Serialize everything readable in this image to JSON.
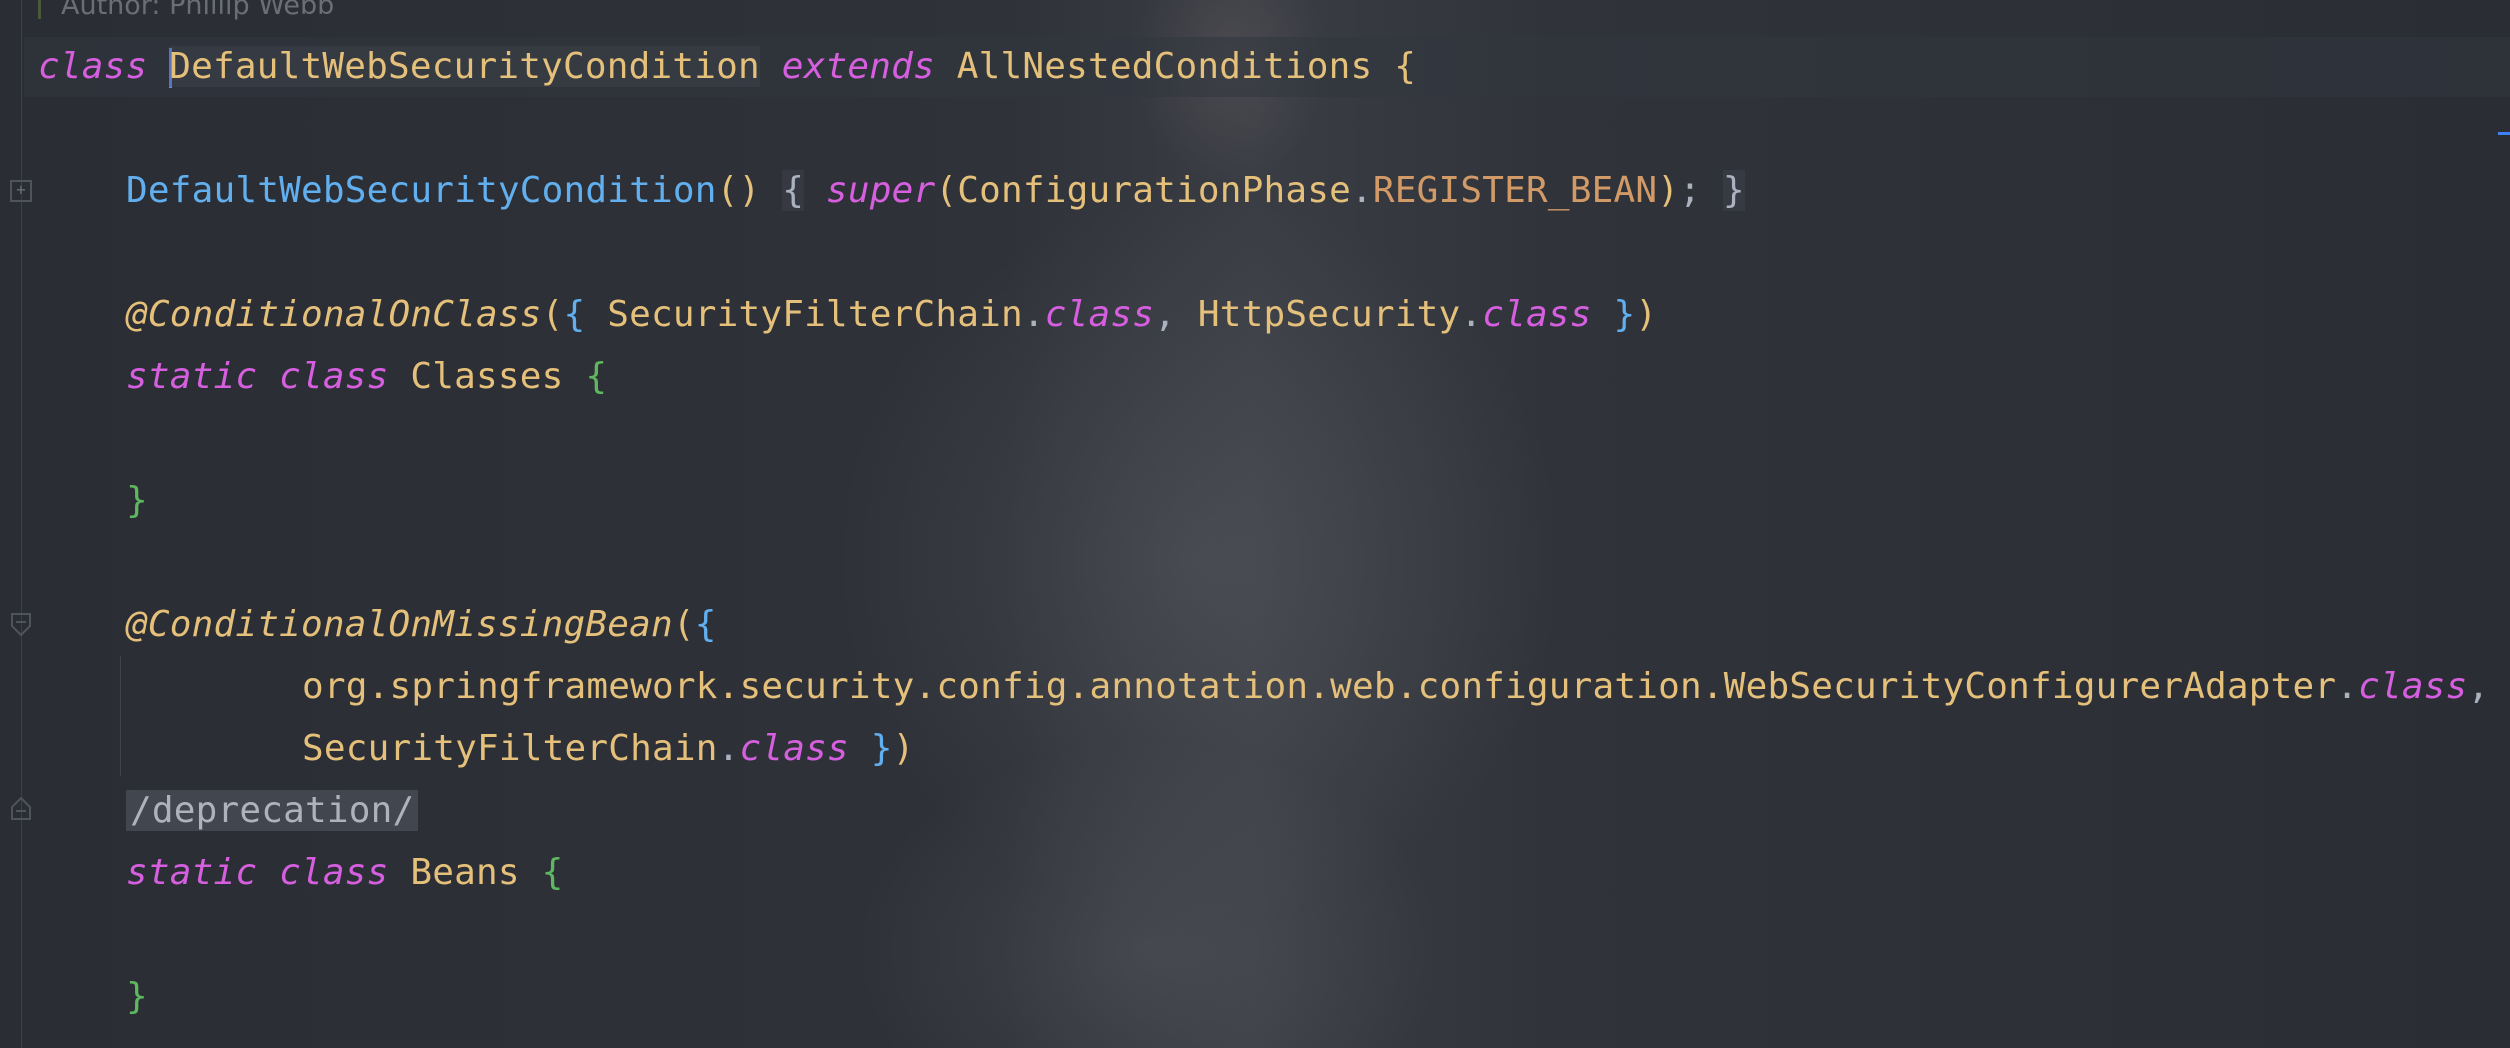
{
  "author_line": "Author: Phillip Webb",
  "colors": {
    "keyword": "#d55fde",
    "type": "#e5c07b",
    "method": "#61afef",
    "constant": "#d19a66",
    "plain": "#abb2bf",
    "brace_green": "#5fb85f",
    "caret": "#5e8ef5",
    "background": "#2b2e35"
  },
  "icons": [
    "fold-expand-icon",
    "fold-collapse-icon",
    "fold-end-icon"
  ],
  "code": {
    "l1": {
      "kw_class": "class",
      "name": "DefaultWebSecurityCondition",
      "kw_extends": "extends",
      "parent": "AllNestedConditions",
      "brace": "{"
    },
    "l2": {
      "ctor": "DefaultWebSecurityCondition",
      "parens": "()",
      "ob": "{",
      "kw_super": "super",
      "lp": "(",
      "type": "ConfigurationPhase",
      "dot": ".",
      "const": "REGISTER_BEAN",
      "rp": ")",
      "semi": ";",
      "cb": "}"
    },
    "l3": {
      "ann": "@ConditionalOnClass",
      "lp": "(",
      "ob": "{",
      "t1": "SecurityFilterChain",
      "dot1": ".",
      "k1": "class",
      "comma": ",",
      "t2": "HttpSecurity",
      "dot2": ".",
      "k2": "class",
      "cb": "}",
      "rp": ")"
    },
    "l4": {
      "kw_static": "static",
      "kw_class": "class",
      "name": "Classes",
      "brace": "{"
    },
    "l5": {
      "brace": "}"
    },
    "l6": {
      "ann": "@ConditionalOnMissingBean",
      "lp": "(",
      "ob": "{"
    },
    "l7": {
      "path": "org.springframework.security.config.annotation.web.configuration.WebSecurityConfigurerAdapter",
      "dot": ".",
      "k": "class",
      "comma": ","
    },
    "l8": {
      "t": "SecurityFilterChain",
      "dot": ".",
      "k": "class",
      "cb": "}",
      "rp": ")"
    },
    "l9": {
      "comment": "/deprecation/"
    },
    "l10": {
      "kw_static": "static",
      "kw_class": "class",
      "name": "Beans",
      "brace": "{"
    },
    "l11": {
      "brace": "}"
    }
  }
}
